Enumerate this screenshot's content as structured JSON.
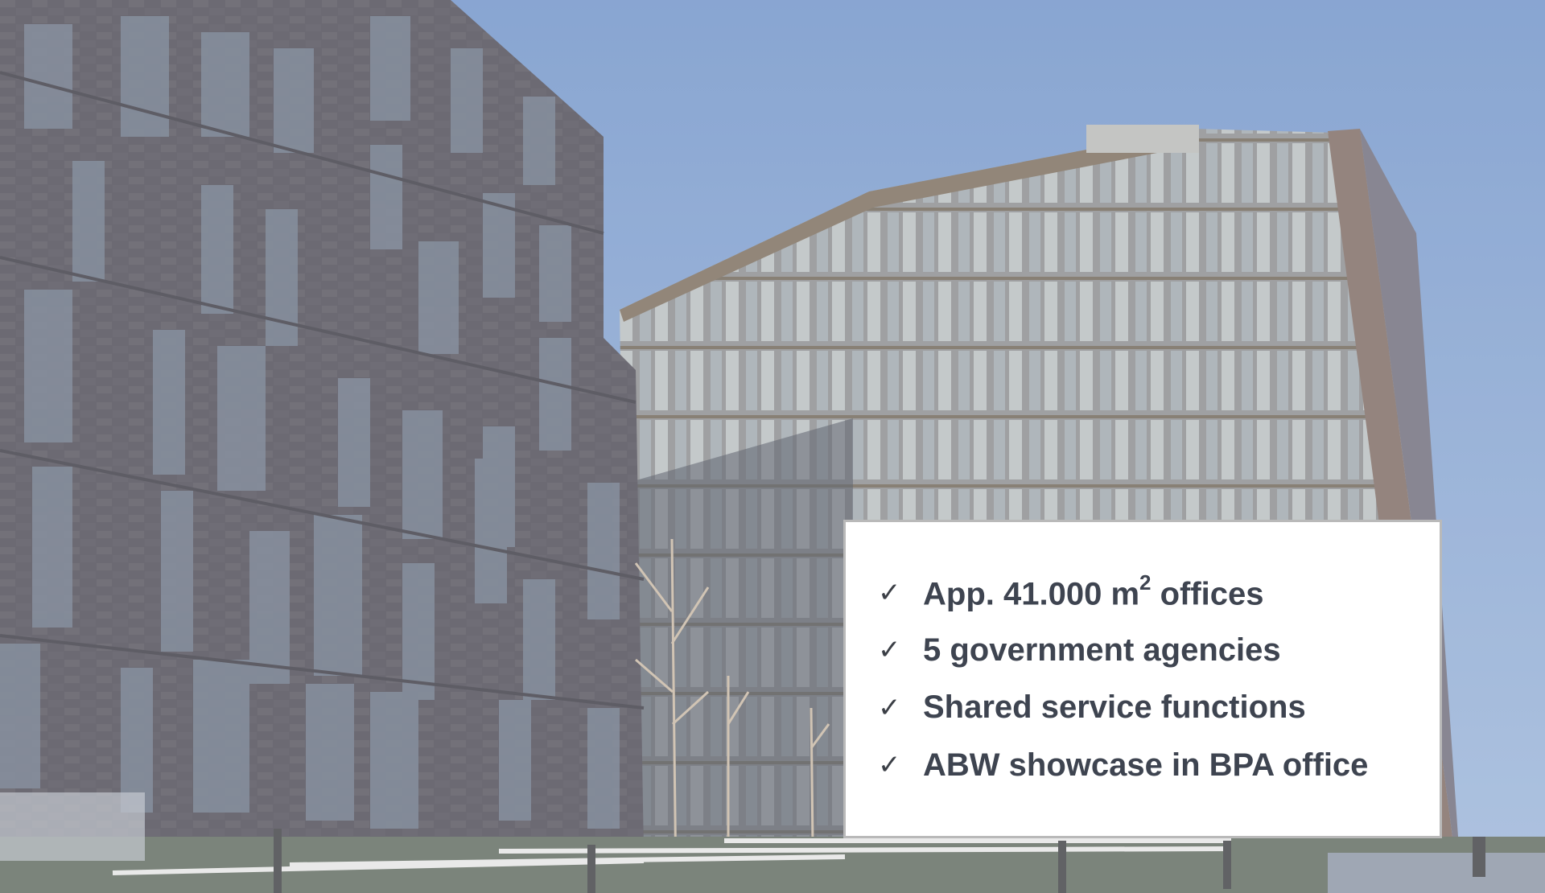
{
  "photo": {
    "subject": "building-photo",
    "sky_color": "#7b9bc9",
    "brick_color": "#4a4852",
    "glass_color": "#6c7580"
  },
  "info_card": {
    "check_symbol": "✓",
    "items": [
      {
        "pre": "App. 41.000 m",
        "sup": "2",
        "post": " offices"
      },
      {
        "pre": "5 government agencies",
        "sup": "",
        "post": ""
      },
      {
        "pre": "Shared service functions",
        "sup": "",
        "post": ""
      },
      {
        "pre": "ABW showcase in BPA office",
        "sup": "",
        "post": ""
      }
    ]
  }
}
